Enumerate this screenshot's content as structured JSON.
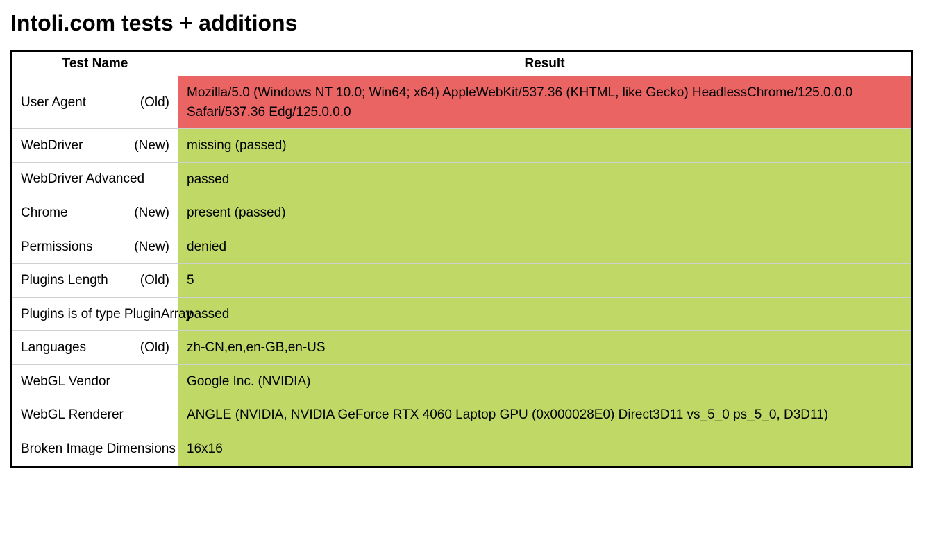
{
  "title": "Intoli.com tests + additions",
  "columns": {
    "name": "Test Name",
    "result": "Result"
  },
  "rows": [
    {
      "name": "User Agent",
      "tag": "(Old)",
      "result": "Mozilla/5.0 (Windows NT 10.0; Win64; x64) AppleWebKit/537.36 (KHTML, like Gecko) HeadlessChrome/125.0.0.0 Safari/537.36 Edg/125.0.0.0",
      "status": "fail"
    },
    {
      "name": "WebDriver",
      "tag": "(New)",
      "result": "missing (passed)",
      "status": "pass"
    },
    {
      "name": "WebDriver Advanced",
      "tag": "",
      "result": "passed",
      "status": "pass"
    },
    {
      "name": "Chrome",
      "tag": "(New)",
      "result": "present (passed)",
      "status": "pass"
    },
    {
      "name": "Permissions",
      "tag": "(New)",
      "result": "denied",
      "status": "pass"
    },
    {
      "name": "Plugins Length",
      "tag": "(Old)",
      "result": "5",
      "status": "pass"
    },
    {
      "name": "Plugins is of type PluginArray",
      "tag": "",
      "result": "passed",
      "status": "pass"
    },
    {
      "name": "Languages",
      "tag": "(Old)",
      "result": "zh-CN,en,en-GB,en-US",
      "status": "pass"
    },
    {
      "name": "WebGL Vendor",
      "tag": "",
      "result": "Google Inc. (NVIDIA)",
      "status": "pass"
    },
    {
      "name": "WebGL Renderer",
      "tag": "",
      "result": "ANGLE (NVIDIA, NVIDIA GeForce RTX 4060 Laptop GPU (0x000028E0) Direct3D11 vs_5_0 ps_5_0, D3D11)",
      "status": "pass"
    },
    {
      "name": "Broken Image Dimensions",
      "tag": "",
      "result": "16x16",
      "status": "pass"
    }
  ]
}
